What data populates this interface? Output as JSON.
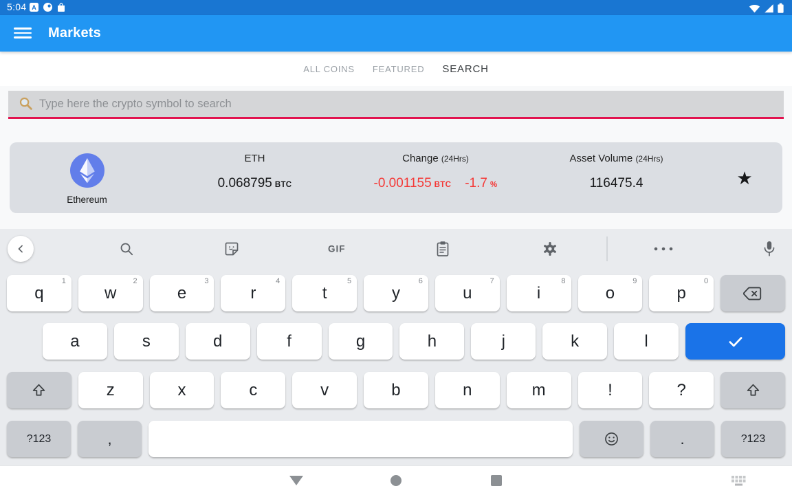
{
  "status_bar": {
    "time": "5:04",
    "left_icons": [
      "letter-a-app-icon",
      "notification-dot-icon",
      "bag-app-icon"
    ],
    "right_icons": [
      "wifi-icon",
      "cell-signal-icon",
      "battery-icon"
    ]
  },
  "app_bar": {
    "title": "Markets",
    "menu_icon": "hamburger-menu-icon"
  },
  "tabs": {
    "items": [
      {
        "label": "ALL COINS",
        "active": false
      },
      {
        "label": "FEATURED",
        "active": false
      },
      {
        "label": "SEARCH",
        "active": true
      }
    ]
  },
  "search": {
    "placeholder": "Type here the crypto symbol to search",
    "value": "",
    "icon": "magnifier-emoji-icon",
    "underline_color": "#e2134f"
  },
  "result_card": {
    "coin": {
      "name": "Ethereum",
      "logo_icon": "ethereum-logo",
      "logo_color": "#627eea"
    },
    "price": {
      "header": "ETH",
      "value": "0.068795",
      "unit": "BTC"
    },
    "change": {
      "header": "Change",
      "period": "(24Hrs)",
      "value": "-0.001155",
      "unit": "BTC",
      "percent": "-1.7",
      "percent_unit": "%",
      "negative_color": "#f43836"
    },
    "volume": {
      "header": "Asset Volume",
      "period": "(24Hrs)",
      "value": "116475.4"
    },
    "favorite_icon": "star-icon"
  },
  "keyboard": {
    "toolbar": {
      "gif_label": "GIF",
      "icons": [
        "back-chevron-icon",
        "search-icon",
        "sticker-icon",
        "gif-button",
        "clipboard-icon",
        "settings-gear-icon",
        "overflow-dots-icon",
        "mic-icon"
      ]
    },
    "rows": [
      {
        "keys": [
          {
            "label": "q",
            "hint": "1"
          },
          {
            "label": "w",
            "hint": "2"
          },
          {
            "label": "e",
            "hint": "3"
          },
          {
            "label": "r",
            "hint": "4"
          },
          {
            "label": "t",
            "hint": "5"
          },
          {
            "label": "y",
            "hint": "6"
          },
          {
            "label": "u",
            "hint": "7"
          },
          {
            "label": "i",
            "hint": "8"
          },
          {
            "label": "o",
            "hint": "9"
          },
          {
            "label": "p",
            "hint": "0"
          },
          {
            "name": "backspace",
            "icon": "backspace-icon",
            "style": "fn"
          }
        ]
      },
      {
        "keys": [
          {
            "label": "a"
          },
          {
            "label": "s"
          },
          {
            "label": "d"
          },
          {
            "label": "f"
          },
          {
            "label": "g"
          },
          {
            "label": "h"
          },
          {
            "label": "j"
          },
          {
            "label": "k"
          },
          {
            "label": "l"
          },
          {
            "name": "enter",
            "icon": "enter-check-icon",
            "style": "enter"
          }
        ]
      },
      {
        "keys": [
          {
            "name": "shift-left",
            "icon": "shift-icon",
            "style": "fn"
          },
          {
            "label": "z"
          },
          {
            "label": "x"
          },
          {
            "label": "c"
          },
          {
            "label": "v"
          },
          {
            "label": "b"
          },
          {
            "label": "n"
          },
          {
            "label": "m"
          },
          {
            "label": "!"
          },
          {
            "label": "?"
          },
          {
            "name": "shift-right",
            "icon": "shift-icon",
            "style": "fn"
          }
        ]
      },
      {
        "keys": [
          {
            "name": "symbols-left",
            "label": "?123",
            "style": "fn"
          },
          {
            "name": "comma",
            "label": ",",
            "style": "fn punct"
          },
          {
            "name": "space",
            "label": "",
            "style": "space"
          },
          {
            "name": "emoji",
            "icon": "emoji-face-icon",
            "style": "fn"
          },
          {
            "name": "period",
            "label": ".",
            "style": "fn punct"
          },
          {
            "name": "symbols-right",
            "label": "?123",
            "style": "fn"
          }
        ]
      }
    ]
  },
  "nav_bar": {
    "icons": [
      "back-triangle-icon",
      "home-circle-icon",
      "recents-square-icon",
      "keyboard-picker-icon"
    ]
  }
}
